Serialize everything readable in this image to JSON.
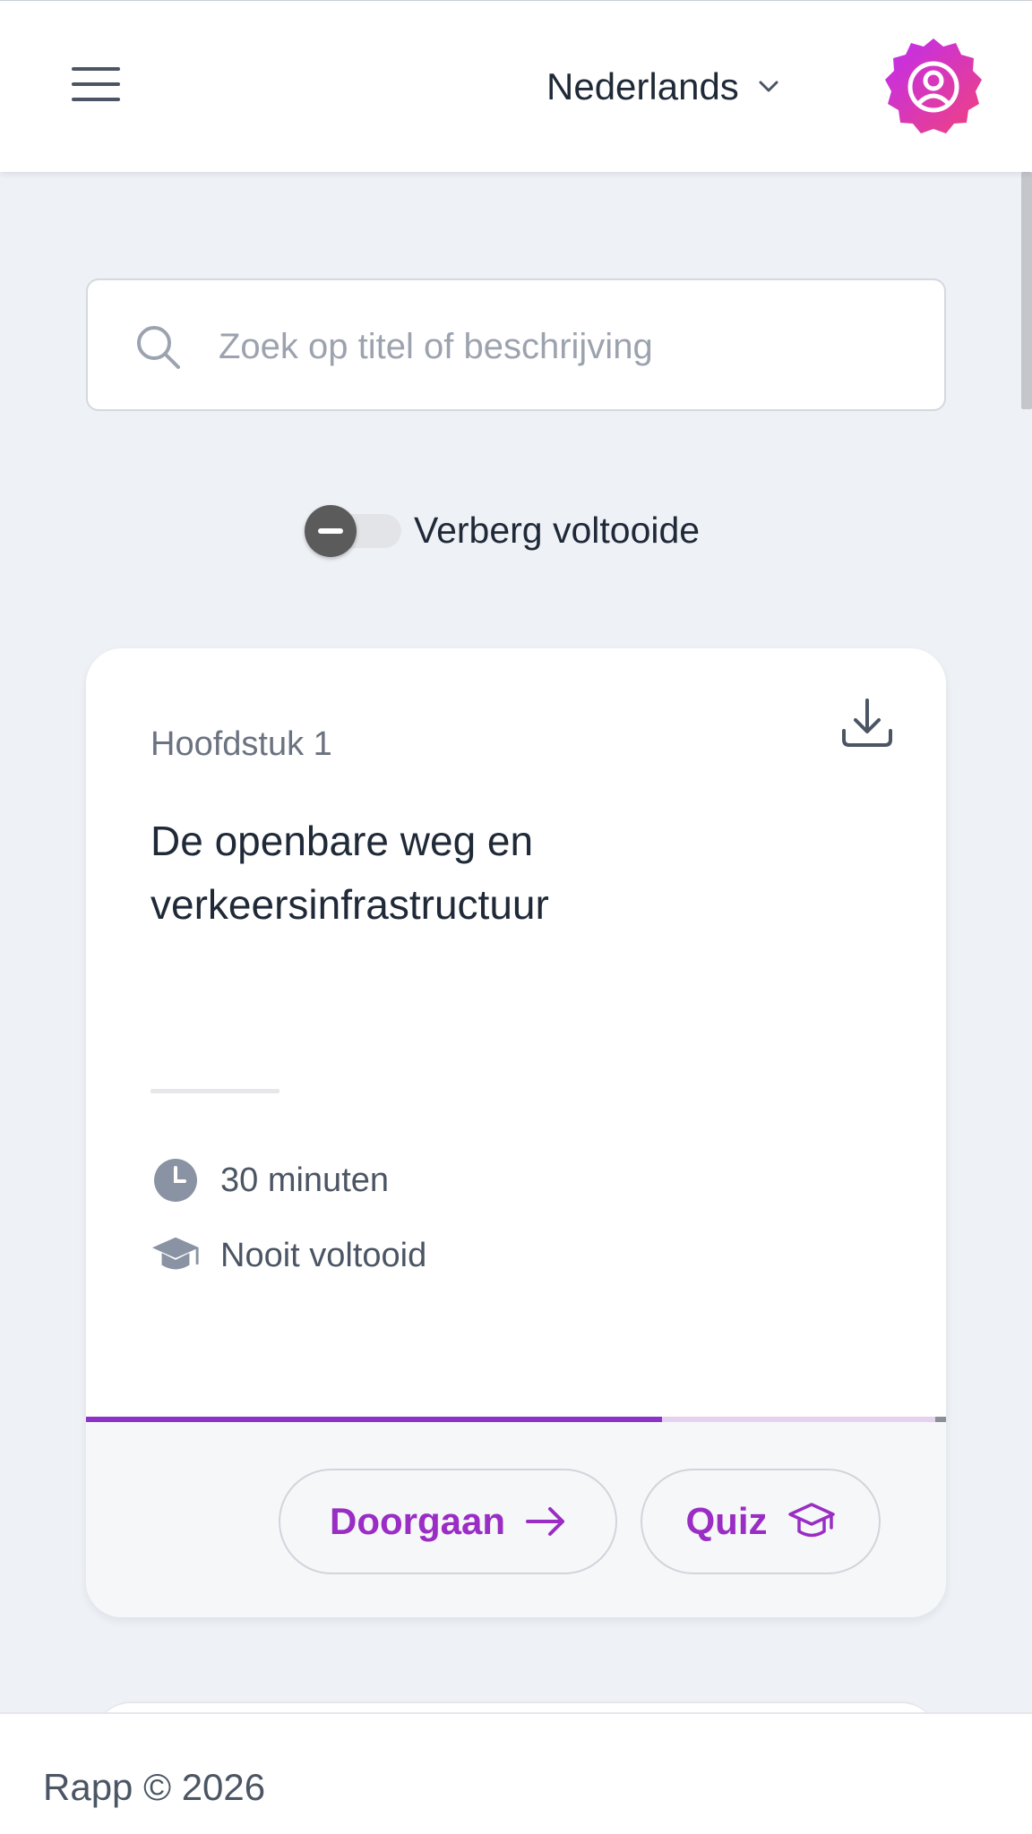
{
  "header": {
    "language": "Nederlands",
    "menu_icon": "hamburger-menu-icon",
    "language_icon": "chevron-down-icon",
    "avatar_icon": "user-circle-icon",
    "avatar_colors": [
      "#c02df0",
      "#f0427e"
    ]
  },
  "search": {
    "placeholder": "Zoek op titel of beschrijving",
    "value": "",
    "icon": "search-icon"
  },
  "filter": {
    "label": "Verberg voltooide",
    "enabled": false
  },
  "chapters": [
    {
      "chapter": "Hoofdstuk 1",
      "title": "De openbare weg en verkeersinfrastructuur",
      "duration": "30 minuten",
      "status": "Nooit voltooid",
      "progress": 0.67,
      "download_icon": "download-icon",
      "continue_label": "Doorgaan",
      "quiz_label": "Quiz"
    }
  ],
  "footer": {
    "text": "Rapp © 2026"
  },
  "colors": {
    "accent": "#9a2dc4",
    "progress": "#8b32c9",
    "background": "#eef1f6"
  }
}
